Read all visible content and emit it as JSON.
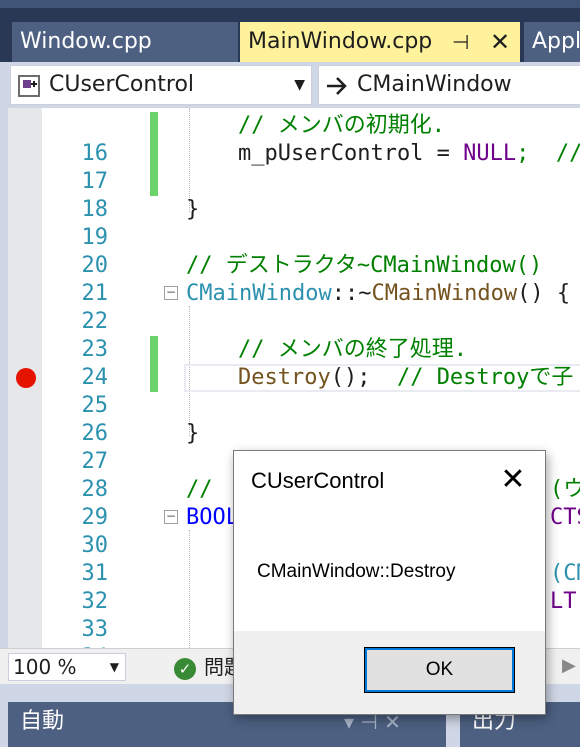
{
  "tabs": [
    {
      "label": "Window.cpp",
      "active": false
    },
    {
      "label": "MainWindow.cpp",
      "active": true,
      "pin": "⊣",
      "close": "✕"
    },
    {
      "label": "Appl",
      "active": false
    }
  ],
  "nav": {
    "class_scope": "CUserControl",
    "member_scope": "CMainWindow",
    "dropdown": "▼"
  },
  "editor": {
    "line_numbers": [
      "16",
      "17",
      "18",
      "19",
      "20",
      "21",
      "22",
      "23",
      "24",
      "25",
      "26",
      "27",
      "28",
      "29",
      "30",
      "31",
      "32",
      "33",
      "34"
    ],
    "fold_collapsed": "−",
    "code": {
      "l16": "// メンバの初期化.",
      "l17_a": "m_pUserControl = ",
      "l17_b": "NULL",
      "l17_c": ";  //",
      "l19": "}",
      "l21": "// デストラクタ~CMainWindow()",
      "l22_a": "CMainWindow",
      "l22_b": "::~",
      "l22_c": "CMainWindow",
      "l22_d": "() {",
      "l24": "// メンバの終了処理.",
      "l25_a": "Destroy",
      "l25_b": "();  ",
      "l25_c": "// Destroyで子",
      "l27": "}",
      "l29_a": "// ",
      "l29_b": "(ウ",
      "l30_a": "BOOL",
      "l30_b": "CTST",
      "l32": "(CMa",
      "l33_a": "LT",
      "l33_b": "(\""
    }
  },
  "status": {
    "zoom": "100 %",
    "issues": "問題",
    "scroll_right": "▶"
  },
  "panels": {
    "auto_title": "自動",
    "auto_controls": "▾ ⊣ ✕",
    "output_title": "出力"
  },
  "dialog": {
    "title": "CUserControl",
    "close": "✕",
    "message": "CMainWindow::Destroy",
    "ok": "OK"
  }
}
